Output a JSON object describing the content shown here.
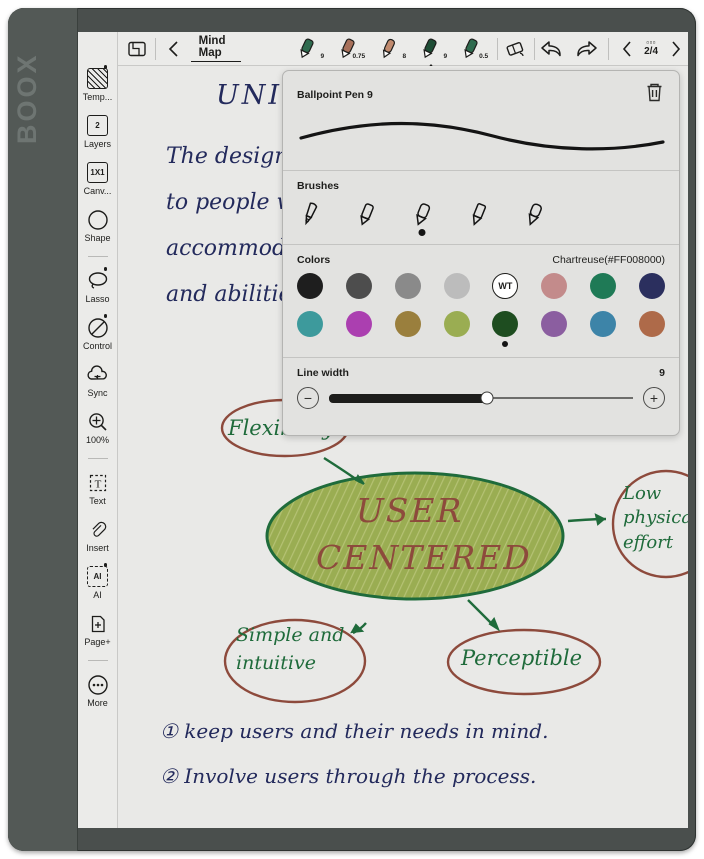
{
  "device": {
    "brand": "BOOX"
  },
  "toolbar": {
    "template_icon": "template-icon",
    "back_icon": "chevron-left-icon",
    "title": "Mind Map",
    "pens": [
      {
        "name": "pen-green-9",
        "size": "9",
        "color": "#2f6b4f",
        "selected": false
      },
      {
        "name": "pen-brown-075",
        "size": "0.75",
        "color": "#a8705a",
        "selected": false
      },
      {
        "name": "pen-tan-8",
        "size": "8",
        "color": "#c08a6e",
        "selected": false
      },
      {
        "name": "pen-darkgreen-9",
        "size": "9",
        "color": "#1e4d35",
        "selected": true
      },
      {
        "name": "pen-green-05",
        "size": "0.5",
        "color": "#2f6b4f",
        "selected": false
      }
    ],
    "eraser_icon": "eraser-icon",
    "undo_icon": "undo-arrow-icon",
    "redo_icon": "redo-arrow-icon",
    "prev_icon": "chevron-left-icon",
    "next_icon": "chevron-right-icon",
    "page_pips": "▫▫▫",
    "page_indicator": "2/4"
  },
  "sidebar": {
    "items": [
      {
        "label": "Temp...",
        "icon": "template-icon",
        "badge": true,
        "value": ""
      },
      {
        "label": "Layers",
        "icon": "layers-icon",
        "badge": false,
        "value": "2"
      },
      {
        "label": "Canv...",
        "icon": "canvas-icon",
        "badge": false,
        "value": "1X1"
      },
      {
        "label": "Shape",
        "icon": "shape-circle-icon",
        "badge": false,
        "value": ""
      },
      {
        "label": "Lasso",
        "icon": "lasso-icon",
        "badge": true,
        "value": ""
      },
      {
        "label": "Control",
        "icon": "control-off-icon",
        "badge": true,
        "value": ""
      },
      {
        "label": "Sync",
        "icon": "sync-cloud-icon",
        "badge": false,
        "value": ""
      },
      {
        "label": "100%",
        "icon": "zoom-in-icon",
        "badge": false,
        "value": ""
      },
      {
        "label": "Text",
        "icon": "text-box-icon",
        "badge": false,
        "value": "T"
      },
      {
        "label": "Insert",
        "icon": "paperclip-icon",
        "badge": false,
        "value": ""
      },
      {
        "label": "AI",
        "icon": "ai-icon",
        "badge": true,
        "value": "AI"
      },
      {
        "label": "Page+",
        "icon": "add-page-icon",
        "badge": false,
        "value": "+"
      },
      {
        "label": "More",
        "icon": "more-dots-icon",
        "badge": false,
        "value": ""
      }
    ]
  },
  "panel": {
    "title": "Ballpoint Pen 9",
    "delete_icon": "trash-icon",
    "brushes_label": "Brushes",
    "brushes": [
      {
        "name": "brush-fountain-pen",
        "selected": false
      },
      {
        "name": "brush-ballpoint",
        "selected": false
      },
      {
        "name": "brush-marker",
        "selected": true
      },
      {
        "name": "brush-pencil",
        "selected": false
      },
      {
        "name": "brush-brush-pen",
        "selected": false
      }
    ],
    "colors_label": "Colors",
    "color_name": "Chartreuse(#FF008000)",
    "colors_row1": [
      {
        "name": "black",
        "hex": "#1e1e1e",
        "selected": false
      },
      {
        "name": "dark-gray",
        "hex": "#4d4d4d",
        "selected": false
      },
      {
        "name": "gray",
        "hex": "#8a8a8a",
        "selected": false
      },
      {
        "name": "light-gray",
        "hex": "#bcbcbc",
        "selected": false
      },
      {
        "name": "white",
        "hex": "#ffffff",
        "selected": false,
        "label": "WT"
      },
      {
        "name": "pink",
        "hex": "#c38b8b",
        "selected": false
      },
      {
        "name": "green",
        "hex": "#1f7a56",
        "selected": false
      },
      {
        "name": "navy",
        "hex": "#2b2f5e",
        "selected": false
      }
    ],
    "colors_row2": [
      {
        "name": "teal",
        "hex": "#3d9a9c",
        "selected": false
      },
      {
        "name": "magenta",
        "hex": "#ab3fb0",
        "selected": false
      },
      {
        "name": "dark-yellow",
        "hex": "#9a7f3d",
        "selected": false
      },
      {
        "name": "olive",
        "hex": "#9aad52",
        "selected": false
      },
      {
        "name": "dark-green",
        "hex": "#1e4d20",
        "selected": true
      },
      {
        "name": "purple",
        "hex": "#8b5ea0",
        "selected": false
      },
      {
        "name": "steel-blue",
        "hex": "#3d84a8",
        "selected": false
      },
      {
        "name": "sienna",
        "hex": "#ae6a49",
        "selected": false
      }
    ],
    "linewidth_label": "Line width",
    "linewidth_value": "9",
    "linewidth_percent": 52,
    "minus_label": "−",
    "plus_label": "+"
  },
  "canvas": {
    "heading": "UNIVERSAL",
    "paragraph": [
      "The design s",
      "to people wit",
      "accommodate",
      "and abilities"
    ],
    "center_node": {
      "line1": "USER",
      "line2": "CENTERED"
    },
    "nodes": [
      {
        "name": "node-flexibility",
        "text": "Flexibility"
      },
      {
        "name": "node-low-effort",
        "text": "Low physical effort"
      },
      {
        "name": "node-simple",
        "text": "Simple and intuitive"
      },
      {
        "name": "node-perceptible",
        "text": "Perceptible"
      }
    ],
    "list": [
      {
        "marker": "①",
        "text": "keep users and their needs in mind."
      },
      {
        "marker": "②",
        "text": "Involve users through the process."
      }
    ]
  }
}
